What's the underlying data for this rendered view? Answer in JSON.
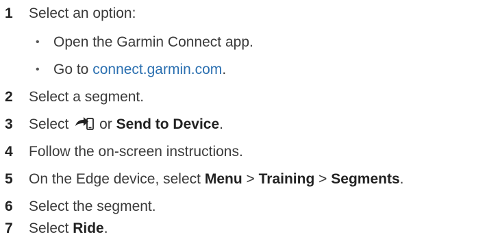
{
  "steps": [
    {
      "number": "1",
      "text": "Select an option:"
    },
    {
      "number": "2",
      "text": "Select a segment."
    },
    {
      "number": "3",
      "prefix": "Select",
      "icon": "send-to-phone-icon",
      "middle": "or",
      "bold": "Send to Device",
      "suffix": "."
    },
    {
      "number": "4",
      "text": "Follow the on-screen instructions."
    },
    {
      "number": "5",
      "prefix": "On the Edge device, select",
      "menu": "Menu",
      "sep1": ">",
      "training": "Training",
      "sep2": ">",
      "segments": "Segments",
      "suffix": "."
    },
    {
      "number": "6",
      "text": "Select the segment."
    },
    {
      "number": "7",
      "prefix": "Select",
      "bold": "Ride",
      "suffix": "."
    }
  ],
  "options": [
    {
      "bullet": "•",
      "text": "Open the Garmin Connect app."
    },
    {
      "bullet": "•",
      "prefix": "Go to",
      "link": "connect.garmin.com",
      "suffix": "."
    }
  ],
  "colors": {
    "text": "#3a3a3a",
    "link": "#2a6fb0"
  }
}
